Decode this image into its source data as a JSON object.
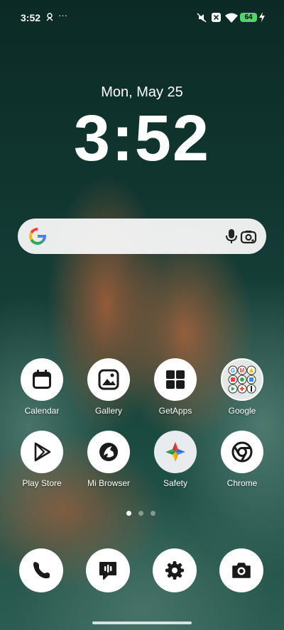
{
  "status_bar": {
    "time": "3:52",
    "more": "···",
    "battery": "64"
  },
  "lockscreen": {
    "date": "Mon, May 25",
    "time": "3:52"
  },
  "search": {
    "google_icon": "google-g-icon",
    "mic_icon": "mic-icon",
    "lens_icon": "google-lens-icon"
  },
  "apps": [
    {
      "label": "Calendar",
      "icon": "calendar-icon"
    },
    {
      "label": "Gallery",
      "icon": "gallery-icon"
    },
    {
      "label": "GetApps",
      "icon": "getapps-icon"
    },
    {
      "label": "Google",
      "icon": "google-folder-icon"
    },
    {
      "label": "Play Store",
      "icon": "play-store-icon"
    },
    {
      "label": "Mi Browser",
      "icon": "mi-browser-icon"
    },
    {
      "label": "Safety",
      "icon": "safety-icon"
    },
    {
      "label": "Chrome",
      "icon": "chrome-icon"
    }
  ],
  "dock": [
    {
      "name": "Phone",
      "icon": "phone-icon"
    },
    {
      "name": "Messages",
      "icon": "messages-icon"
    },
    {
      "name": "Settings",
      "icon": "settings-icon"
    },
    {
      "name": "Camera",
      "icon": "camera-icon"
    }
  ],
  "page_indicator": {
    "pages": 3,
    "current": 1
  },
  "colors": {
    "google_blue": "#4285F4",
    "google_red": "#EA4335",
    "google_yellow": "#FBBC05",
    "google_green": "#34A853",
    "battery_green": "#4cd964"
  }
}
